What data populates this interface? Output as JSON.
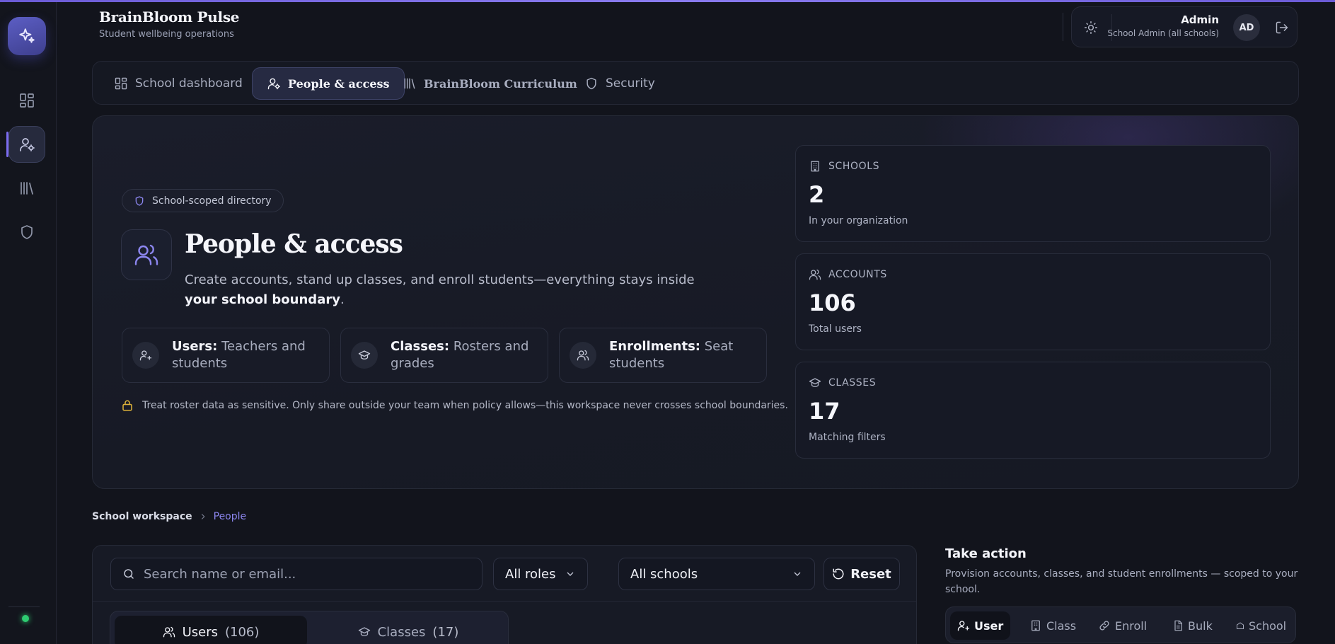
{
  "app": {
    "title": "BrainBloom Pulse",
    "subtitle": "Student wellbeing operations"
  },
  "user": {
    "name": "Admin",
    "role": "School Admin (all schools)",
    "initials": "AD"
  },
  "rail": {
    "items": [
      {
        "icon": "grid-icon",
        "active": false
      },
      {
        "icon": "user-cog-icon",
        "active": true
      },
      {
        "icon": "library-icon",
        "active": false
      },
      {
        "icon": "shield-icon",
        "active": false
      }
    ],
    "status_color": "#2ecc71"
  },
  "tabs": [
    {
      "label": "School dashboard",
      "icon": "grid-icon",
      "active": false
    },
    {
      "label": "People & access",
      "icon": "user-cog-icon",
      "active": true
    },
    {
      "label": "BrainBloom Curriculum",
      "icon": "library-icon",
      "active": false
    },
    {
      "label": "Security",
      "icon": "shield-icon",
      "active": false
    }
  ],
  "hero": {
    "chip": "School-scoped directory",
    "title": "People & access",
    "desc_prefix": "Create accounts, stand up classes, and enroll students—everything stays inside ",
    "desc_bold": "your school boundary",
    "desc_suffix": ".",
    "features": [
      {
        "title": "Users:",
        "text": "Teachers and students",
        "icon": "user-plus-icon"
      },
      {
        "title": "Classes:",
        "text": "Rosters and grades",
        "icon": "graduation-cap-icon"
      },
      {
        "title": "Enrollments:",
        "text": "Seat students",
        "icon": "users-icon"
      }
    ],
    "notice": "Treat roster data as sensitive. Only share outside your team when policy allows—this workspace never crosses school boundaries."
  },
  "stats": [
    {
      "label": "SCHOOLS",
      "value": "2",
      "sub": "In your organization",
      "icon": "building-icon"
    },
    {
      "label": "ACCOUNTS",
      "value": "106",
      "sub": "Total users",
      "icon": "users-icon"
    },
    {
      "label": "CLASSES",
      "value": "17",
      "sub": "Matching filters",
      "icon": "graduation-cap-icon"
    }
  ],
  "breadcrumb": {
    "home": "School workspace",
    "current": "People"
  },
  "filters": {
    "search_placeholder": "Search name or email...",
    "role": "All roles",
    "school": "All schools",
    "reset": "Reset"
  },
  "segments": [
    {
      "label": "Users",
      "count": "(106)",
      "active": true
    },
    {
      "label": "Classes",
      "count": "(17)",
      "active": false
    }
  ],
  "action": {
    "title": "Take action",
    "desc": "Provision accounts, classes, and student enrollments — scoped to your school.",
    "tabs": [
      {
        "label": "User",
        "active": true
      },
      {
        "label": "Class",
        "active": false
      },
      {
        "label": "Enroll",
        "active": false
      },
      {
        "label": "Bulk",
        "active": false
      },
      {
        "label": "School",
        "active": false
      }
    ]
  },
  "colors": {
    "accent": "#7b6cf0",
    "background": "#12141c",
    "warning": "#e0b43a"
  }
}
